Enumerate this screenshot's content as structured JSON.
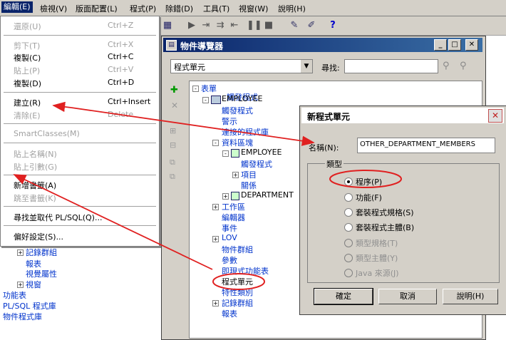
{
  "menubar": {
    "items": [
      "編輯(E)",
      "檢視(V)",
      "版面配置(L)",
      "程式(P)",
      "除錯(D)",
      "工具(T)",
      "視窗(W)",
      "說明(H)"
    ]
  },
  "edit_menu": {
    "items": [
      {
        "label": "還原(U)",
        "shortcut": "Ctrl+Z",
        "disabled": true
      },
      {
        "label": "剪下(T)",
        "shortcut": "Ctrl+X",
        "disabled": true
      },
      {
        "label": "複製(C)",
        "shortcut": "Ctrl+C",
        "disabled": false
      },
      {
        "label": "貼上(P)",
        "shortcut": "Ctrl+V",
        "disabled": true
      },
      {
        "label": "複製(D)",
        "shortcut": "Ctrl+D",
        "disabled": false
      },
      {
        "label": "建立(R)",
        "shortcut": "Ctrl+Insert",
        "disabled": false
      },
      {
        "label": "清除(E)",
        "shortcut": "Delete",
        "disabled": true
      },
      {
        "label": "SmartClasses(M)",
        "shortcut": "",
        "disabled": true
      },
      {
        "label": "貼上名稱(N)",
        "shortcut": "",
        "disabled": true
      },
      {
        "label": "貼上引數(G)",
        "shortcut": "",
        "disabled": true
      },
      {
        "label": "新增書籤(A)",
        "shortcut": "",
        "disabled": false
      },
      {
        "label": "跳至書籤(K)",
        "shortcut": "",
        "disabled": true
      },
      {
        "label": "尋找並取代 PL/SQL(Q)...",
        "shortcut": "",
        "disabled": false
      },
      {
        "label": "偏好設定(S)...",
        "shortcut": "",
        "disabled": false
      }
    ]
  },
  "left_bg": {
    "items": [
      "記錄群組",
      "報表",
      "視覺屬性",
      "視窗",
      "功能表",
      "PL/SQL 程式庫",
      "物件程式庫"
    ]
  },
  "navigator": {
    "title": "物件導覽器",
    "combo_value": "程式單元",
    "find_label": "尋找:",
    "tree": {
      "forms": "表單",
      "employee": "EMPLOYEE",
      "triggers": "觸發程式",
      "alerts": "警示",
      "attached_libs": "連接的程式庫",
      "blocks": "資料區塊",
      "block_employee": "EMPLOYEE",
      "block_triggers": "觸發程式",
      "items": "項目",
      "relations": "關係",
      "department": "DEPARTMENT",
      "canvases": "工作區",
      "editors": "編輯器",
      "events": "事件",
      "lov": "LOV",
      "object_groups": "物件群組",
      "parameters": "參數",
      "popup_menus": "即現式功能表",
      "program_units": "程式單元",
      "property_classes": "特性類別",
      "record_groups": "記錄群組",
      "reports": "報表",
      "behind_text": "觸發程式"
    }
  },
  "dialog": {
    "title": "新程式單元",
    "name_label": "名稱(N):",
    "name_value": "OTHER_DEPARTMENT_MEMBERS",
    "type_group": "類型",
    "types": [
      {
        "label": "程序(P)",
        "selected": true,
        "disabled": false
      },
      {
        "label": "功能(F)",
        "selected": false,
        "disabled": false
      },
      {
        "label": "套裝程式規格(S)",
        "selected": false,
        "disabled": false
      },
      {
        "label": "套裝程式主體(B)",
        "selected": false,
        "disabled": false
      },
      {
        "label": "類型規格(T)",
        "selected": false,
        "disabled": true
      },
      {
        "label": "類型主體(Y)",
        "selected": false,
        "disabled": true
      },
      {
        "label": "Java 來源(J)",
        "selected": false,
        "disabled": true
      }
    ],
    "ok_label": "確定",
    "cancel_label": "取消",
    "help_label": "說明(H)"
  },
  "colors": {
    "arrow": "#e02020",
    "highlight_circle": "#e02020",
    "title_bar": "#0a246a"
  }
}
